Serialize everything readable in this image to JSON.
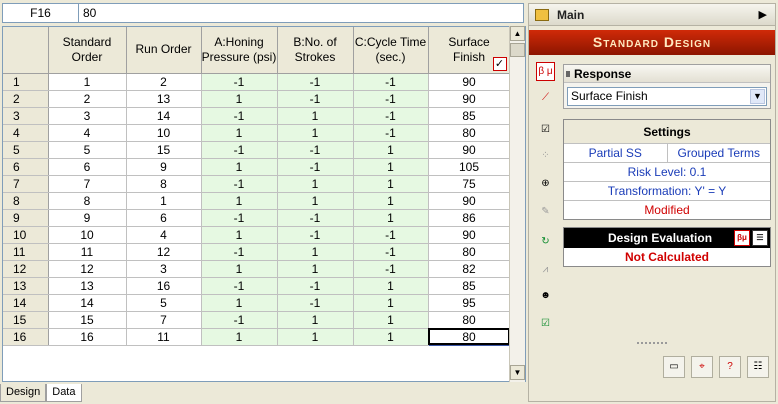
{
  "formula": {
    "cell_ref": "F16",
    "value": "80"
  },
  "grid": {
    "columns": [
      "Standard Order",
      "Run Order",
      "A:Honing Pressure (psi)",
      "B:No. of Strokes",
      "C:Cycle Time (sec.)",
      "Surface Finish"
    ],
    "rows": [
      [
        "1",
        "1",
        "2",
        "-1",
        "-1",
        "-1",
        "90"
      ],
      [
        "2",
        "2",
        "13",
        "1",
        "-1",
        "-1",
        "90"
      ],
      [
        "3",
        "3",
        "14",
        "-1",
        "1",
        "-1",
        "85"
      ],
      [
        "4",
        "4",
        "10",
        "1",
        "1",
        "-1",
        "80"
      ],
      [
        "5",
        "5",
        "15",
        "-1",
        "-1",
        "1",
        "90"
      ],
      [
        "6",
        "6",
        "9",
        "1",
        "-1",
        "1",
        "105"
      ],
      [
        "7",
        "7",
        "8",
        "-1",
        "1",
        "1",
        "75"
      ],
      [
        "8",
        "8",
        "1",
        "1",
        "1",
        "1",
        "90"
      ],
      [
        "9",
        "9",
        "6",
        "-1",
        "-1",
        "1",
        "86"
      ],
      [
        "10",
        "10",
        "4",
        "1",
        "-1",
        "-1",
        "90"
      ],
      [
        "11",
        "11",
        "12",
        "-1",
        "1",
        "-1",
        "80"
      ],
      [
        "12",
        "12",
        "3",
        "1",
        "1",
        "-1",
        "82"
      ],
      [
        "13",
        "13",
        "16",
        "-1",
        "-1",
        "1",
        "85"
      ],
      [
        "14",
        "14",
        "5",
        "1",
        "-1",
        "1",
        "95"
      ],
      [
        "15",
        "15",
        "7",
        "-1",
        "1",
        "1",
        "80"
      ],
      [
        "16",
        "16",
        "11",
        "1",
        "1",
        "1",
        "80"
      ]
    ]
  },
  "tabs": [
    "Design",
    "Data"
  ],
  "panel": {
    "title": "Main",
    "banner": "Standard Design",
    "response": {
      "label": "Response",
      "selected": "Surface Finish"
    },
    "settings": {
      "title": "Settings",
      "partial_ss": "Partial SS",
      "grouped_terms": "Grouped Terms",
      "risk_level": "Risk Level: 0.1",
      "transformation": "Transformation: Y' = Y",
      "modified": "Modified"
    },
    "evaluation": {
      "title": "Design Evaluation",
      "status": "Not Calculated"
    }
  },
  "icons": {
    "toolbar": [
      "beta-mu-icon",
      "line-chart-icon",
      "checklist-ab-icon",
      "scatter-icon",
      "target-icon",
      "pencil-icon",
      "refresh-y-icon",
      "trend-icon",
      "people-icon",
      "checkbox-list-icon"
    ],
    "bottom": [
      "folder-icon",
      "report-icon",
      "help-icon",
      "notes-icon"
    ]
  },
  "colors": {
    "factor_bg": "#e6f9e2",
    "banner": "#b02008",
    "alert": "#d00000"
  }
}
